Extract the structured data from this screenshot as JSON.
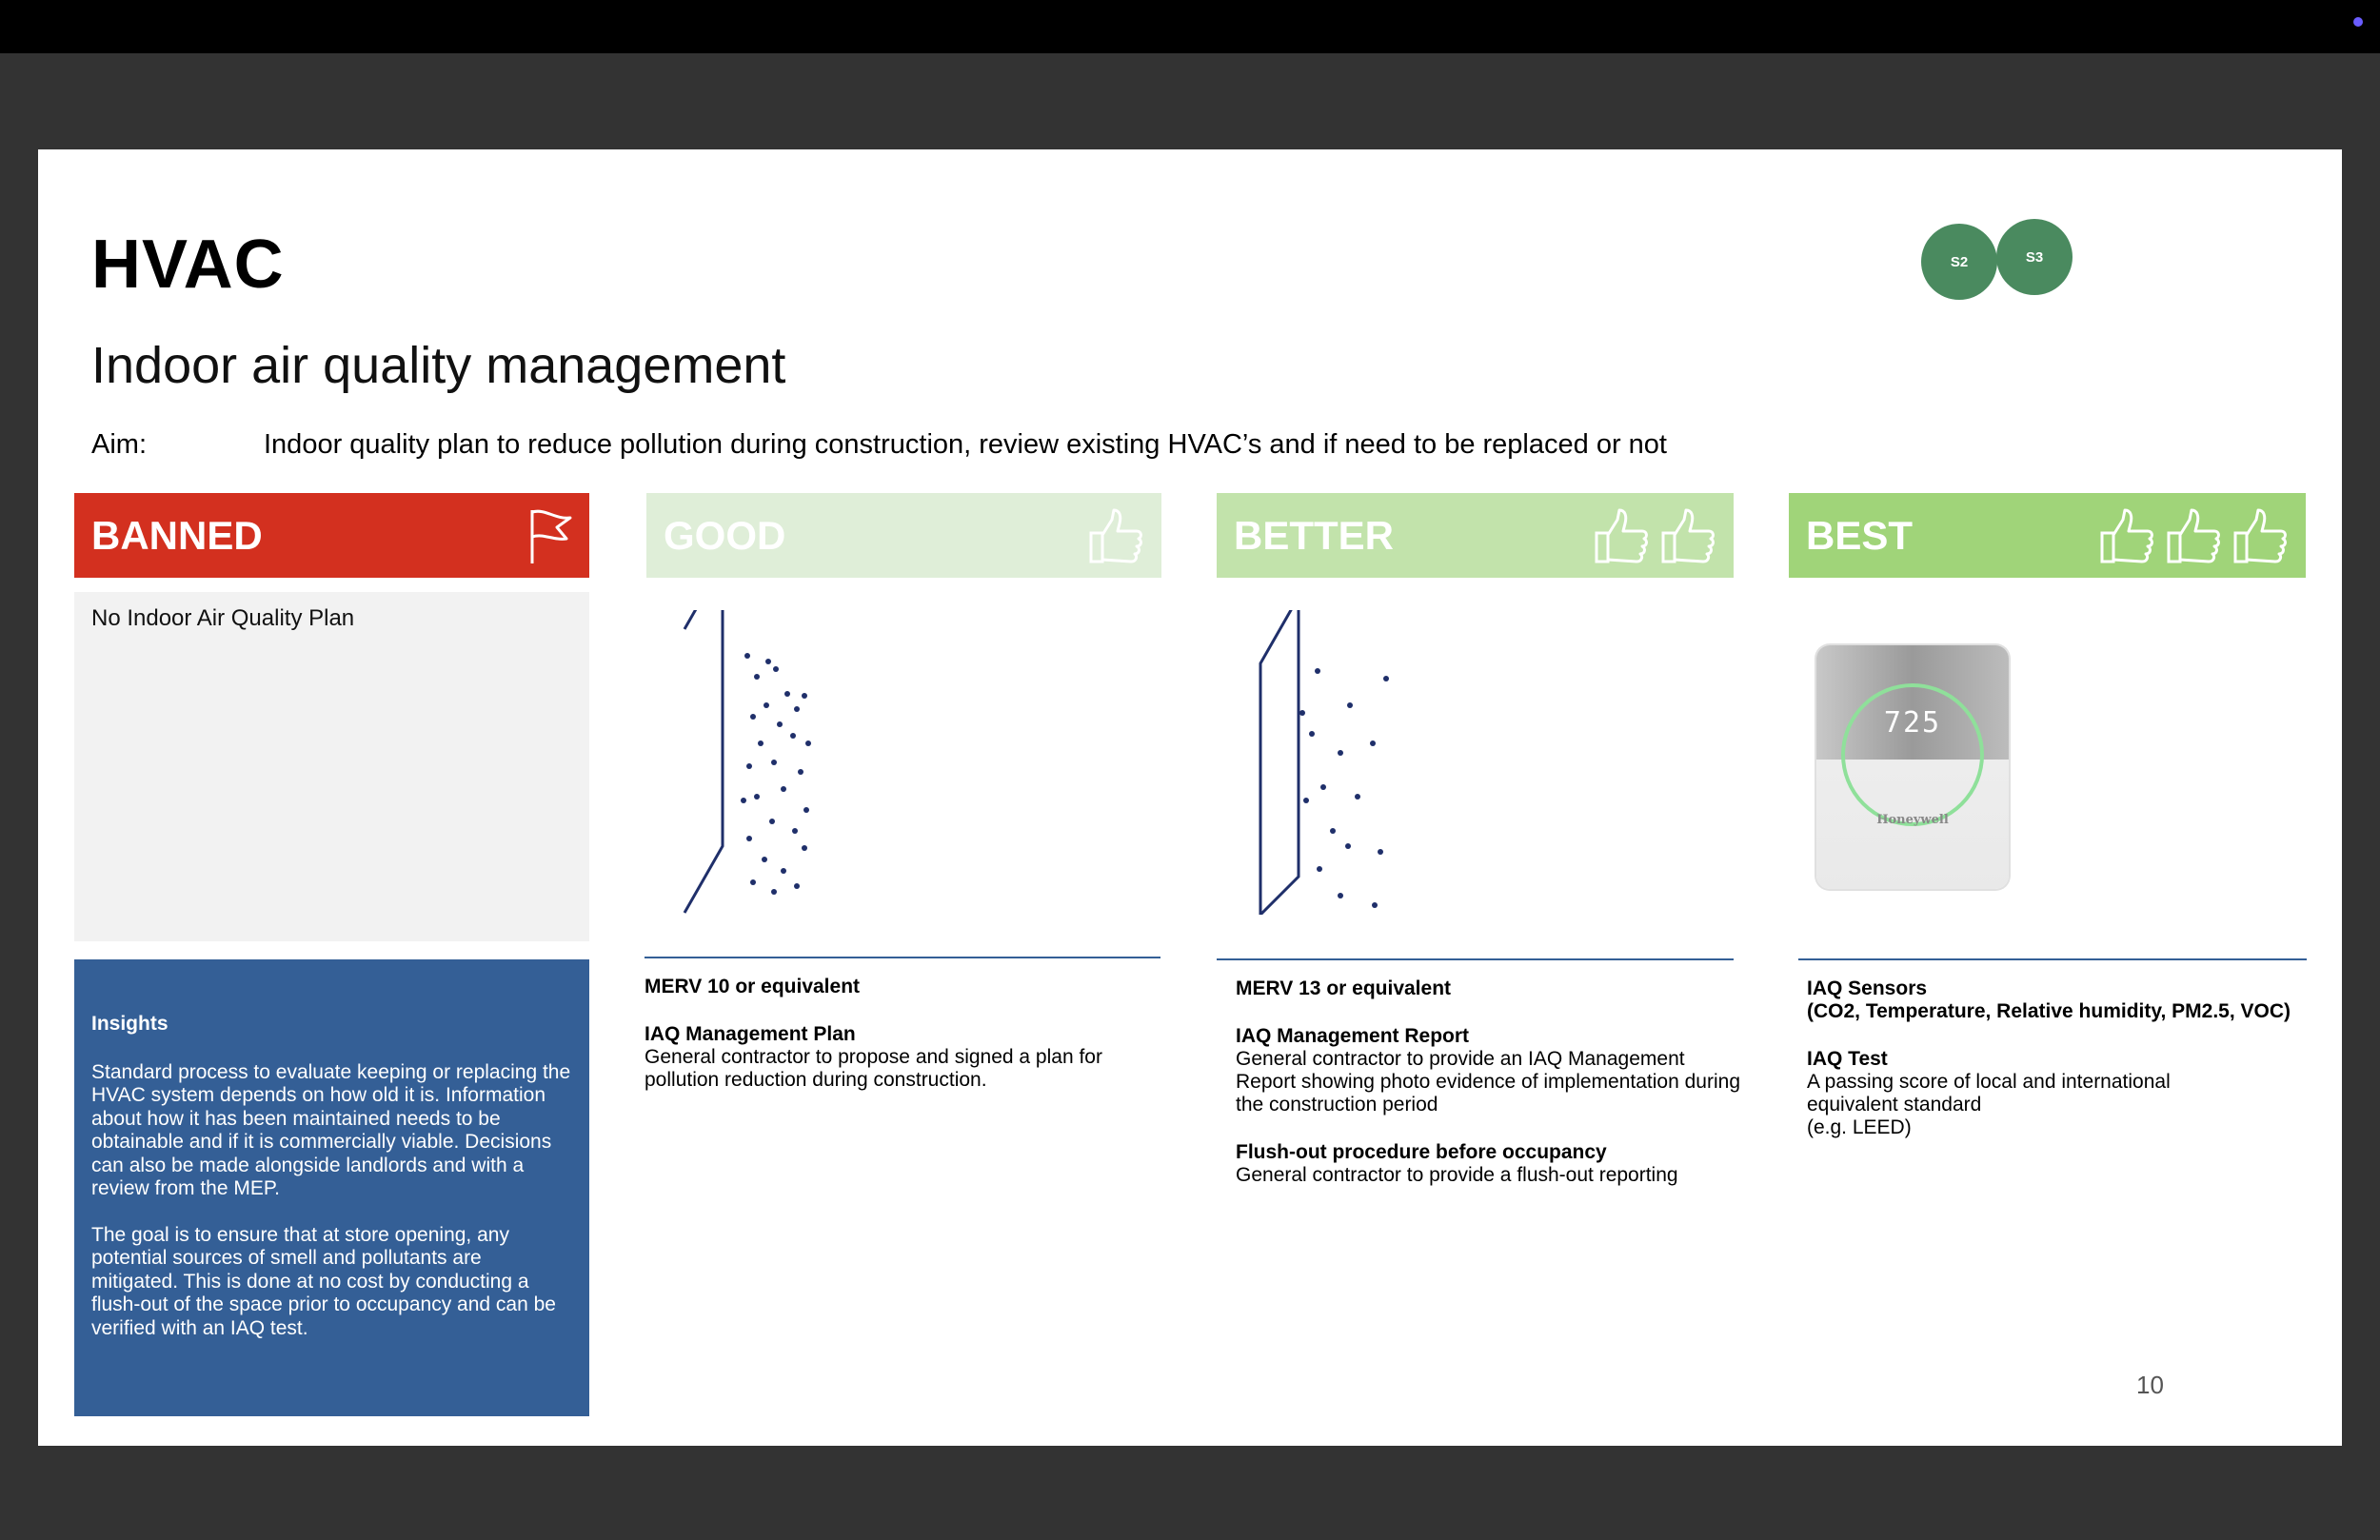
{
  "slide": {
    "title": "HVAC",
    "subtitle": "Indoor air quality management",
    "aim_label": "Aim:",
    "aim_text": "Indoor quality plan to reduce pollution during construction, review existing HVAC’s and if need to be replaced or not",
    "badges": [
      "S2",
      "S3"
    ],
    "page_number": "10"
  },
  "colors": {
    "banned": "#d3301f",
    "good": "#dfeed8",
    "better": "#c2e3ab",
    "best": "#a0d479",
    "insights_bg": "#345f96",
    "badge": "#4a8a5f"
  },
  "banned": {
    "label": "BANNED",
    "icon": "flag-icon",
    "text": "No Indoor Air Quality Plan",
    "insights_title": "Insights",
    "insights_p1": "Standard process to evaluate keeping or replacing the HVAC system depends on how old it is. Information about how it has been maintained needs to be obtainable and if it is commercially viable. Decisions can also be made alongside landlords and with a review from the MEP.",
    "insights_p2": "The goal is to ensure that at store opening, any potential sources of smell and pollutants are mitigated. This is done at no cost by conducting a flush-out of the space prior to occupancy and can be verified with an IAQ test."
  },
  "good": {
    "label": "GOOD",
    "icon": "thumbs-up-icon",
    "line1": "MERV 10 or equivalent",
    "item_title": "IAQ Management Plan",
    "item_text": "General contractor to propose and signed a plan for pollution reduction during construction."
  },
  "better": {
    "label": "BETTER",
    "icon": "thumbs-up-icon",
    "line1": "MERV 13 or equivalent",
    "item1_title": "IAQ Management  Report",
    "item1_text": "General contractor to provide an IAQ Management Report showing photo evidence of implementation during the construction period",
    "item2_title": "Flush-out procedure before occupancy",
    "item2_text": "General contractor to provide a flush-out reporting"
  },
  "best": {
    "label": "BEST",
    "icon": "thumbs-up-icon",
    "item1_title": "IAQ Sensors",
    "item1_sub": "(CO2, Temperature, Relative humidity, PM2.5, VOC)",
    "item2_title": "IAQ Test",
    "item2_text": "A passing score of local and  international equivalent standard",
    "item2_note": "(e.g. LEED)",
    "device_reading": "725",
    "device_brand": "Honeywell"
  }
}
